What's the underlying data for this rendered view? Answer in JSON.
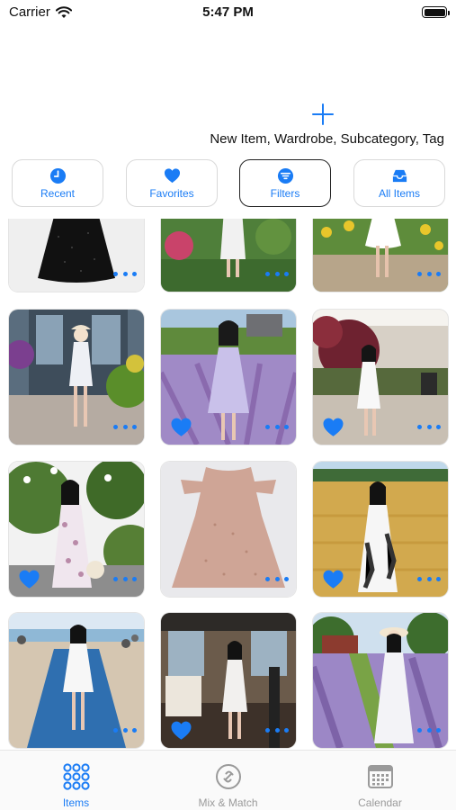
{
  "status_bar": {
    "carrier": "Carrier",
    "time": "5:47 PM"
  },
  "actions": {
    "new_item_label": "New Item, Wardrobe, Subcategory, Tag"
  },
  "segments": [
    {
      "label": "Recent",
      "icon": "clock-icon",
      "active": false
    },
    {
      "label": "Favorites",
      "icon": "heart-icon",
      "active": false
    },
    {
      "label": "Filters",
      "icon": "filter-icon",
      "active": true
    },
    {
      "label": "All Items",
      "icon": "tray-icon",
      "active": false
    }
  ],
  "items": [
    {
      "scene": "black-dress",
      "favorite": false
    },
    {
      "scene": "garden-white-dress",
      "favorite": false
    },
    {
      "scene": "sunflower-field-white-dress",
      "favorite": false
    },
    {
      "scene": "storefront-white-dress",
      "favorite": false
    },
    {
      "scene": "lavender-lilac-dress",
      "favorite": true
    },
    {
      "scene": "garden-path-white-dress",
      "favorite": true
    },
    {
      "scene": "flower-bush-floral-dress",
      "favorite": true
    },
    {
      "scene": "pink-dress-flatlay",
      "favorite": false
    },
    {
      "scene": "wheat-field-floral-dress",
      "favorite": true
    },
    {
      "scene": "boardwalk-white-dress",
      "favorite": false
    },
    {
      "scene": "mall-lobby-white-dress",
      "favorite": true
    },
    {
      "scene": "lavender-farm-hat-dress",
      "favorite": false
    }
  ],
  "tab_bar": {
    "tabs": [
      {
        "label": "Items",
        "icon": "grid-dots-icon",
        "active": true
      },
      {
        "label": "Mix & Match",
        "icon": "link-circle-icon",
        "active": false
      },
      {
        "label": "Calendar",
        "icon": "calendar-icon",
        "active": false
      }
    ]
  },
  "colors": {
    "accent": "#1a7cf5",
    "inactive": "#9a9a9a"
  }
}
